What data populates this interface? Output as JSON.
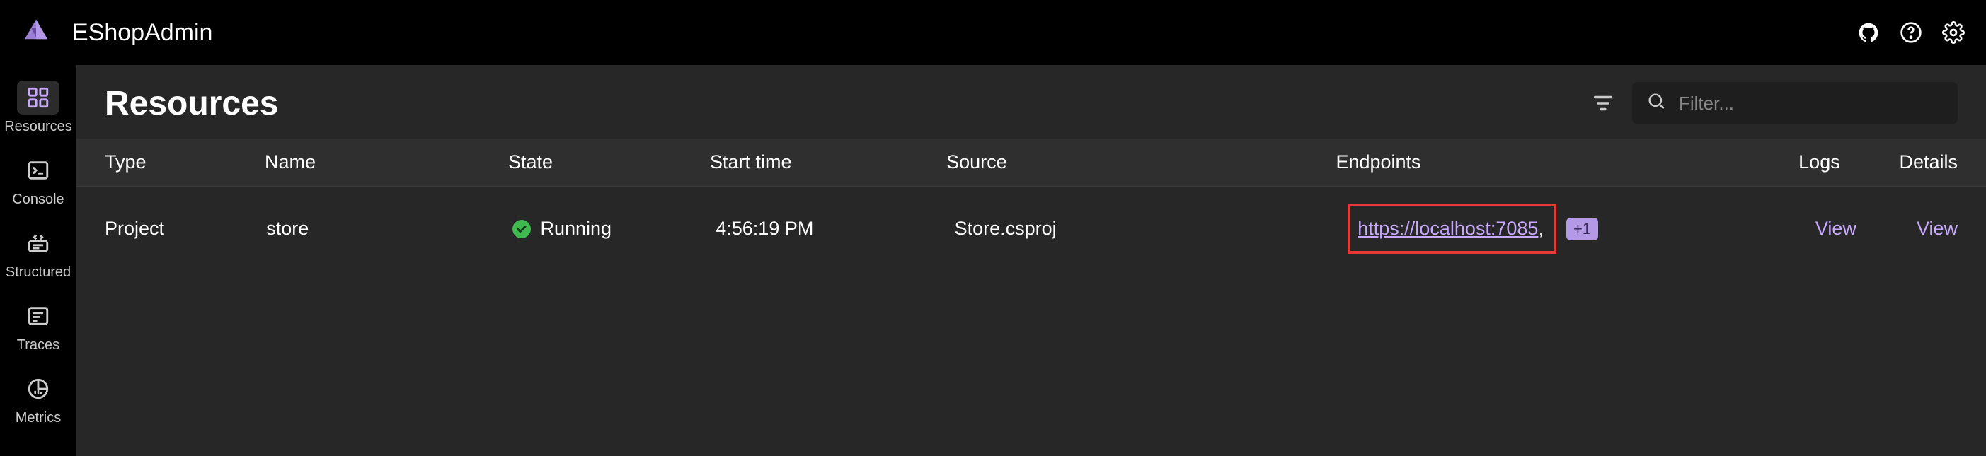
{
  "header": {
    "app_title": "EShopAdmin"
  },
  "sidebar": {
    "items": [
      {
        "label": "Resources"
      },
      {
        "label": "Console"
      },
      {
        "label": "Structured"
      },
      {
        "label": "Traces"
      },
      {
        "label": "Metrics"
      }
    ]
  },
  "page": {
    "title": "Resources",
    "search_placeholder": "Filter..."
  },
  "table": {
    "columns": {
      "type": "Type",
      "name": "Name",
      "state": "State",
      "start": "Start time",
      "source": "Source",
      "endpoints": "Endpoints",
      "logs": "Logs",
      "details": "Details"
    },
    "rows": [
      {
        "type": "Project",
        "name": "store",
        "state": "Running",
        "start": "4:56:19 PM",
        "source": "Store.csproj",
        "endpoint_url": "https://localhost:7085",
        "endpoint_extra": "+1",
        "logs_link": "View",
        "details_link": "View"
      }
    ]
  },
  "colors": {
    "accent": "#c9a8ff",
    "status_running": "#3fb950",
    "highlight_border": "#e53935"
  }
}
